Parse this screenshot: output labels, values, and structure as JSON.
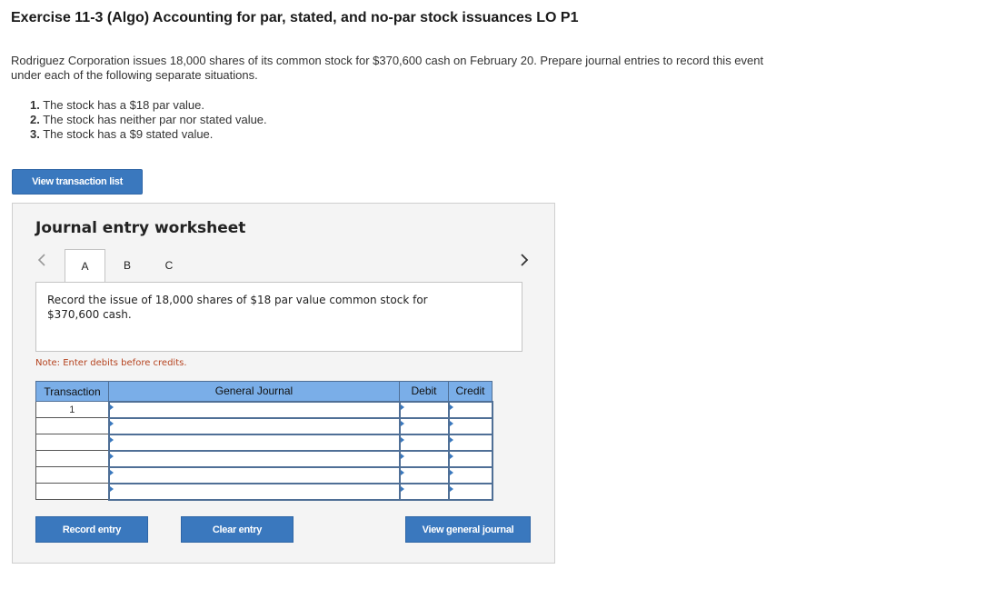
{
  "exercise": {
    "title": "Exercise 11-3 (Algo) Accounting for par, stated, and no-par stock issuances LO P1",
    "intro": "Rodriguez Corporation issues 18,000 shares of its common stock for $370,600 cash on February 20. Prepare journal entries to record this event under each of the following separate situations.",
    "requirements": [
      {
        "num": "1.",
        "text": "The stock has a $18 par value."
      },
      {
        "num": "2.",
        "text": "The stock has neither par nor stated value."
      },
      {
        "num": "3.",
        "text": "The stock has a $9 stated value."
      }
    ]
  },
  "buttons": {
    "view_transaction_list": "View transaction list",
    "record_entry": "Record entry",
    "clear_entry": "Clear entry",
    "view_general_journal": "View general journal"
  },
  "worksheet": {
    "title": "Journal entry worksheet",
    "tabs": [
      "A",
      "B",
      "C"
    ],
    "active_tab": "A",
    "instruction": "Record the issue of 18,000 shares of $18 par value common stock for $370,600 cash.",
    "note": "Note: Enter debits before credits.",
    "table": {
      "headers": [
        "Transaction",
        "General Journal",
        "Debit",
        "Credit"
      ],
      "rows": [
        {
          "transaction": "1",
          "account": "",
          "debit": "",
          "credit": ""
        },
        {
          "transaction": "",
          "account": "",
          "debit": "",
          "credit": ""
        },
        {
          "transaction": "",
          "account": "",
          "debit": "",
          "credit": ""
        },
        {
          "transaction": "",
          "account": "",
          "debit": "",
          "credit": ""
        },
        {
          "transaction": "",
          "account": "",
          "debit": "",
          "credit": ""
        },
        {
          "transaction": "",
          "account": "",
          "debit": "",
          "credit": ""
        }
      ]
    }
  },
  "icons": {
    "prev": "chevron-left-icon",
    "next": "chevron-right-icon"
  },
  "colors": {
    "button_blue": "#3a78be",
    "header_blue": "#7aaee8",
    "note_orange": "#b5431f",
    "panel_gray": "#f4f4f4"
  }
}
